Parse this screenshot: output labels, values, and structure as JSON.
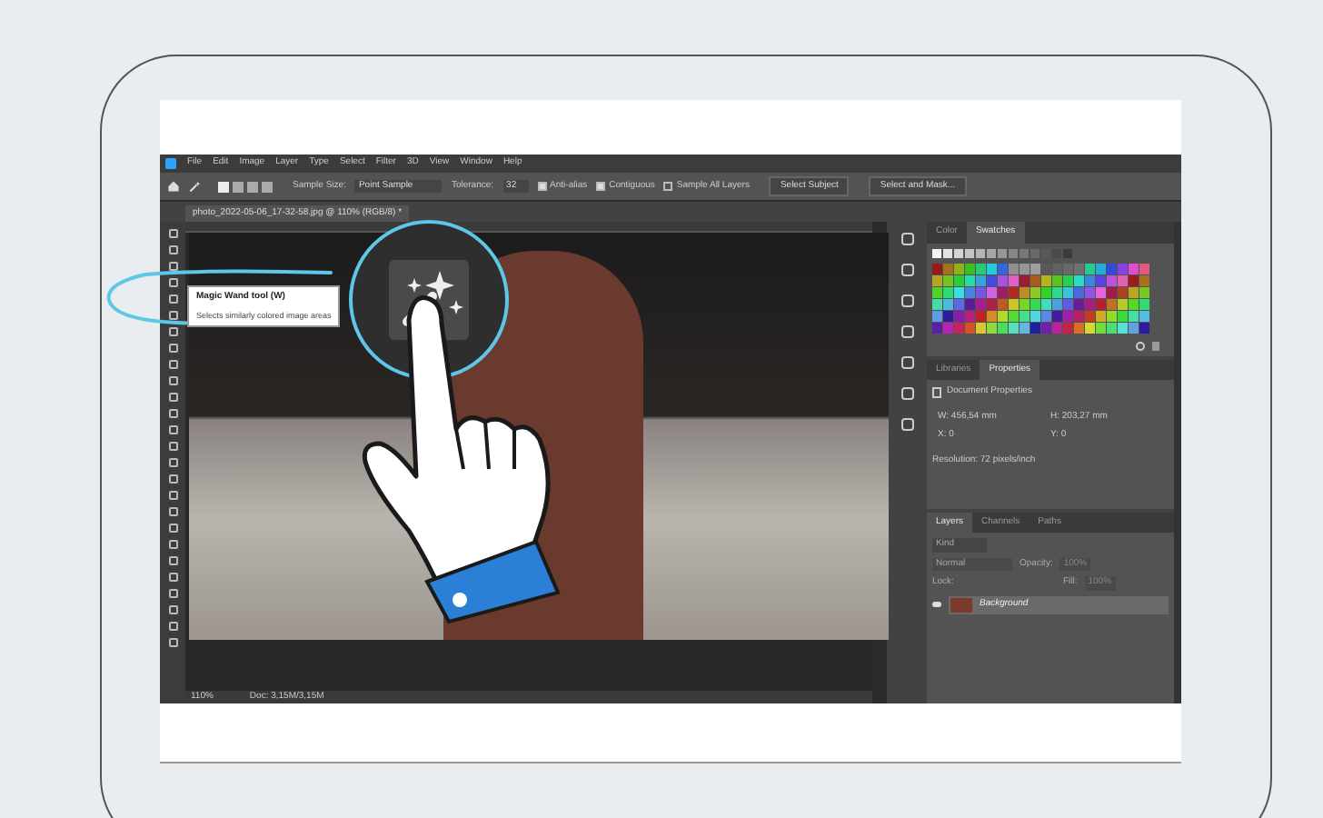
{
  "menu": [
    "File",
    "Edit",
    "Image",
    "Layer",
    "Type",
    "Select",
    "Filter",
    "3D",
    "View",
    "Window",
    "Help"
  ],
  "options_bar": {
    "sample_size_label": "Sample Size:",
    "sample_size": "Point Sample",
    "tolerance_label": "Tolerance:",
    "tolerance": "32",
    "checks": [
      {
        "label": "Anti-alias",
        "checked": true
      },
      {
        "label": "Contiguous",
        "checked": true
      },
      {
        "label": "Sample All Layers",
        "checked": false
      }
    ],
    "buttons": [
      "Select Subject",
      "Select and Mask..."
    ]
  },
  "document_tab": "photo_2022-05-06_17-32-58.jpg @ 110% (RGB/8) *",
  "tooltip": {
    "title": "Magic Wand tool (W)",
    "description": "Selects similarly colored image areas"
  },
  "swatches_panel": {
    "tabs": [
      {
        "label": "Color",
        "selected": false
      },
      {
        "label": "Swatches",
        "selected": true
      }
    ]
  },
  "properties_panel": {
    "tabs": [
      {
        "label": "Libraries",
        "selected": false
      },
      {
        "label": "Properties",
        "selected": true
      }
    ],
    "heading": "Document Properties",
    "fields": [
      "W: 456,54 mm",
      "H: 203,27 mm",
      "X: 0",
      "Y: 0"
    ],
    "resolution": "Resolution: 72 pixels/inch"
  },
  "layers_panel": {
    "tabs": [
      {
        "label": "Layers",
        "selected": true
      },
      {
        "label": "Channels",
        "selected": false
      },
      {
        "label": "Paths",
        "selected": false
      }
    ],
    "filter": "Kind",
    "blend_mode": "Normal",
    "opacity_label": "Opacity:",
    "opacity": "100%",
    "lock_label": "Lock:",
    "fill_label": "Fill:",
    "fill": "100%",
    "layers": [
      {
        "name": "Background",
        "visible": true,
        "selected": true
      }
    ]
  },
  "status_bar": {
    "zoom": "110%",
    "doc": "Doc: 3,15M/3,15M"
  }
}
